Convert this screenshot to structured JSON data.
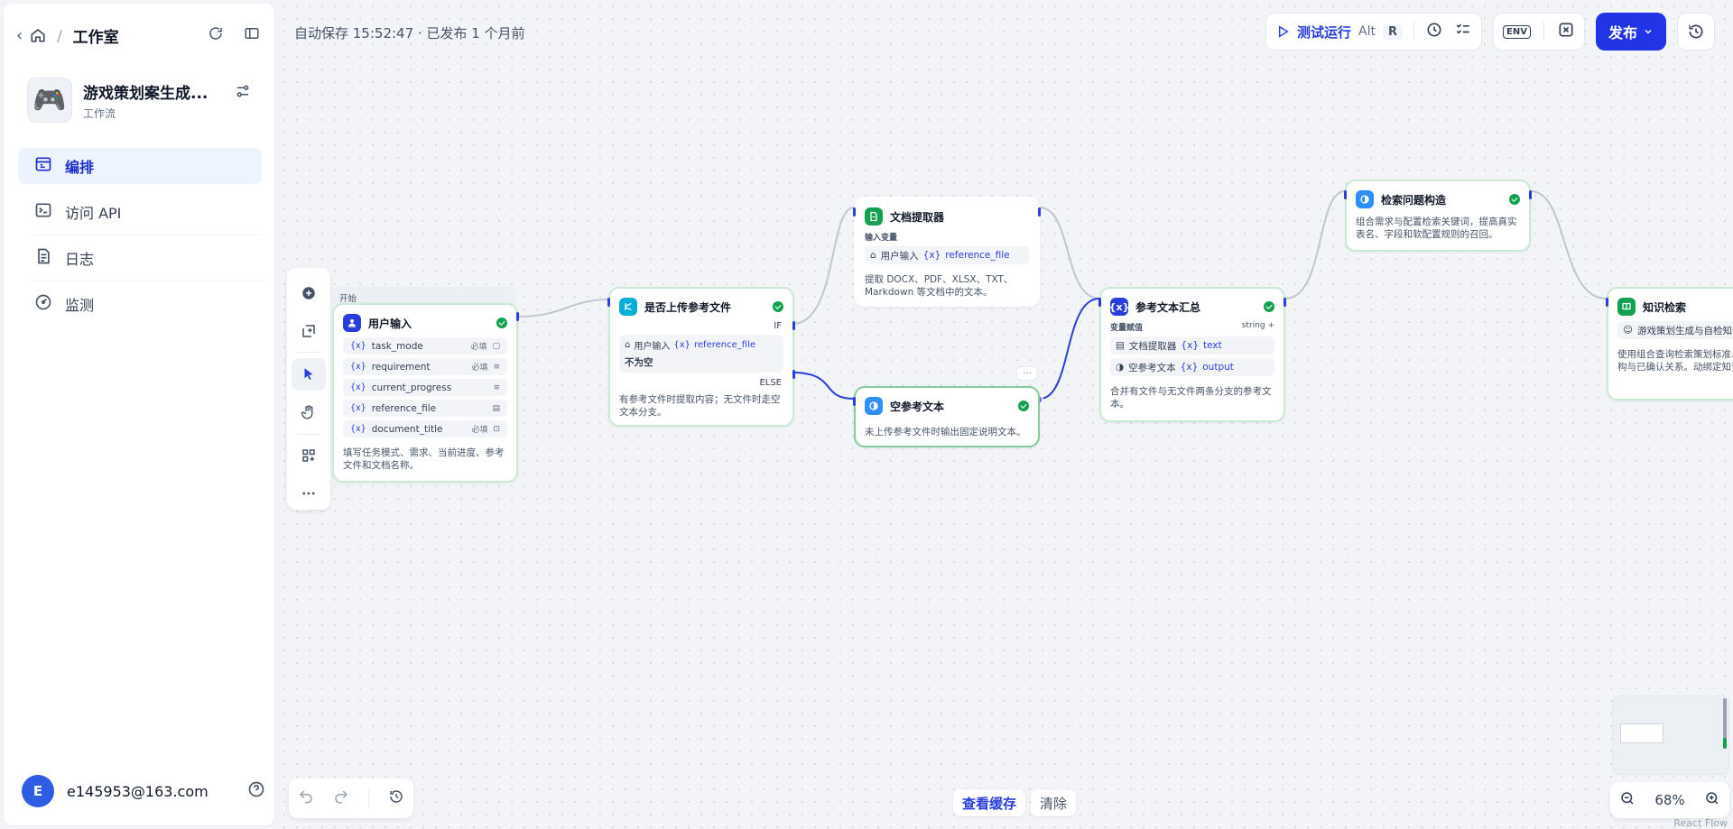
{
  "sidebar": {
    "breadcrumb_title": "工作室",
    "app": {
      "avatar": "🎮",
      "name": "游戏策划案生成...",
      "type": "工作流"
    },
    "nav": [
      {
        "label": "编排",
        "icon": "layout-icon",
        "active": true
      },
      {
        "label": "访问 API",
        "icon": "terminal-icon",
        "active": false
      },
      {
        "label": "日志",
        "icon": "log-icon",
        "active": false
      },
      {
        "label": "监测",
        "icon": "gauge-icon",
        "active": false
      }
    ],
    "user": {
      "initial": "E",
      "email": "e145953@163.com"
    }
  },
  "header": {
    "autosave": "自动保存 15:52:47 · 已发布 1 个月前",
    "run_label": "测试运行",
    "run_kbd1": "Alt",
    "run_kbd2": "R",
    "env_label": "ENV",
    "publish_label": "发布"
  },
  "nodes": {
    "start_label": "开始",
    "user_input": {
      "title": "用户输入",
      "vars": [
        {
          "name": "task_mode",
          "tag": "必填"
        },
        {
          "name": "requirement",
          "tag": "必填"
        },
        {
          "name": "current_progress",
          "tag": ""
        },
        {
          "name": "reference_file",
          "tag": ""
        },
        {
          "name": "document_title",
          "tag": "必填"
        }
      ],
      "desc": "填写任务模式、需求、当前进度、参考文件和文档名称。"
    },
    "if_node": {
      "title": "是否上传参考文件",
      "if_label": "IF",
      "cond_source": "用户输入",
      "cond_var": "reference_file",
      "cond_op": "不为空",
      "else_label": "ELSE",
      "desc": "有参考文件时提取内容；无文件时走空文本分支。"
    },
    "doc_extract": {
      "title": "文档提取器",
      "input_label": "输入变量",
      "source": "用户输入",
      "var": "reference_file",
      "desc": "提取 DOCX、PDF、XLSX、TXT、Markdown 等文档中的文本。"
    },
    "empty_text": {
      "title": "空参考文本",
      "desc": "未上传参考文件时输出固定说明文本。"
    },
    "aggregator": {
      "title": "参考文本汇总",
      "assign_label": "变量赋值",
      "type_label": "string",
      "rows": [
        {
          "source": "文档提取器",
          "var": "text"
        },
        {
          "source": "空参考文本",
          "var": "output"
        }
      ],
      "desc": "合并有文件与无文件两条分支的参考文本。"
    },
    "query_build": {
      "title": "检索问题构造",
      "desc": "组合需求与配置检索关键词，提高真实表名、字段和软配置规则的召回。"
    },
    "knowledge": {
      "title": "知识检索",
      "kb_name": "游戏策划生成与自检知识",
      "desc": "使用组合查询检索策划标准、真实表结构与已确认关系。动绑定知识库。"
    }
  },
  "bottom": {
    "view_cache": "查看缓存",
    "clear": "清除",
    "zoom": "68%",
    "attribution": "React Flow"
  },
  "colors": {
    "accent": "#2135e6",
    "success": "#12a150",
    "node_border": "#c8ead4"
  }
}
